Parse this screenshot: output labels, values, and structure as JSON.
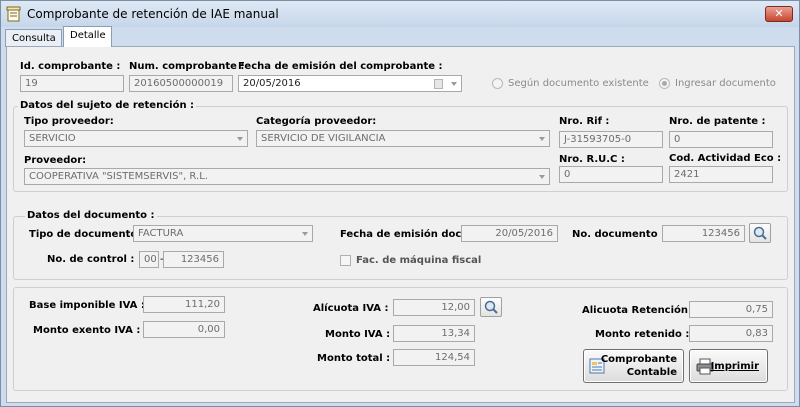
{
  "window": {
    "title": "Comprobante de retención de IAE manual",
    "close_label": "✕"
  },
  "tabs": [
    {
      "label": "Consulta"
    },
    {
      "label": "Detalle"
    }
  ],
  "header": {
    "id_label": "Id. comprobante :",
    "id_value": "19",
    "num_label": "Num. comprobante :",
    "num_value": "20160500000019",
    "fecha_label": "Fecha de emisión del comprobante :",
    "fecha_value": "20/05/2016",
    "radio_existing": "Según documento existente",
    "radio_manual": "Ingresar documento"
  },
  "sujeto": {
    "title": "Datos del sujeto de retención :",
    "tipo_label": "Tipo proveedor:",
    "tipo_value": "SERVICIO",
    "categoria_label": "Categoría proveedor:",
    "categoria_value": "SERVICIO DE VIGILANCIA",
    "rif_label": "Nro. Rif :",
    "rif_value": "J-31593705-0",
    "patente_label": "Nro. de patente :",
    "patente_value": "0",
    "proveedor_label": "Proveedor:",
    "proveedor_value": "COOPERATIVA \"SISTEMSERVIS\", R.L.",
    "ruc_label": "Nro. R.U.C :",
    "ruc_value": "0",
    "actividad_label": "Cod. Actividad Eco :",
    "actividad_value": "2421"
  },
  "documento": {
    "title": "Datos del documento :",
    "tipo_label": "Tipo de documento:",
    "tipo_value": "FACTURA",
    "fecha_label": "Fecha de emisión doc. :",
    "fecha_value": "20/05/2016",
    "nodoc_label": "No. documento :",
    "nodoc_value": "123456",
    "control_label": "No. de control :",
    "control_prefix": "00",
    "control_sep": "-",
    "control_value": "123456",
    "fiscal_label": "Fac. de máquina fiscal"
  },
  "montos": {
    "base_label": "Base imponible IVA :",
    "base_value": "111,20",
    "exento_label": "Monto exento IVA :",
    "exento_value": "0,00",
    "alicuota_label": "Alícuota IVA :",
    "alicuota_value": "12,00",
    "monto_iva_label": "Monto IVA :",
    "monto_iva_value": "13,34",
    "total_label": "Monto total :",
    "total_value": "124,54",
    "ret_label": "Alicuota Retención :",
    "ret_value": "0,75",
    "retenido_label": "Monto retenido :",
    "retenido_value": "0,83"
  },
  "buttons": {
    "comprobante_line1": "Comprobante",
    "comprobante_line2": "Contable",
    "imprimir": "Imprimir"
  }
}
